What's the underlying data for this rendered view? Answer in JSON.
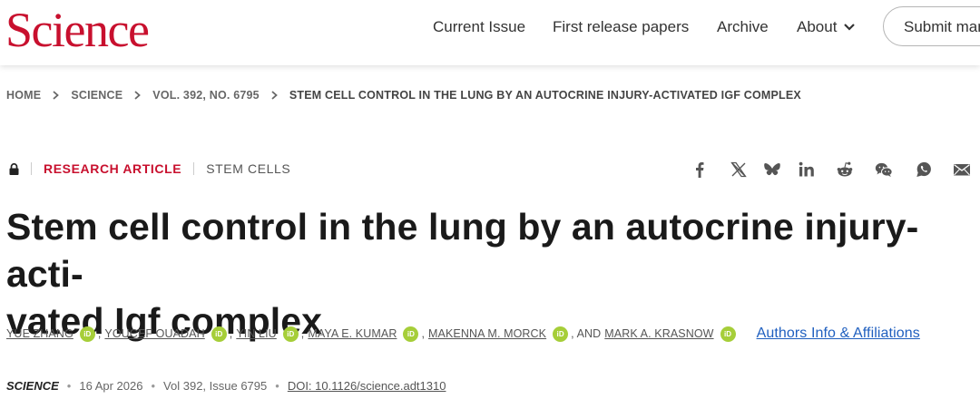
{
  "header": {
    "logo": "Science",
    "nav": [
      "Current Issue",
      "First release papers",
      "Archive",
      "About"
    ],
    "submit_label": "Submit manuscript"
  },
  "breadcrumb": [
    "HOME",
    "SCIENCE",
    "VOL. 392, NO. 6795",
    "STEM CELL CONTROL IN THE LUNG BY AN AUTOCRINE INJURY-ACTIVATED IGF COMPLEX"
  ],
  "article": {
    "type": "RESEARCH ARTICLE",
    "subject": "STEM CELLS",
    "title_lines": [
      "Stem cell control in the lung by an autocrine injury-acti-",
      "vated Igf complex"
    ],
    "orcid_label": "iD",
    "authors": [
      "YUE ZHANG",
      "YOUCEF OUADAH",
      "YIN LIU",
      "MAYA E. KUMAR",
      "MAKENNA M. MORCK",
      "MARK A. KRASNOW"
    ],
    "author_sep": ",",
    "and_label": ", AND",
    "affiliations_link": "Authors Info & Affiliations",
    "citation": {
      "journal": "SCIENCE",
      "date": "16 Apr 2026",
      "volume_issue": "Vol 392, Issue 6795",
      "doi": "DOI: 10.1126/science.adt1310",
      "separator": "•"
    }
  },
  "share_icons": [
    "facebook-icon",
    "x-twitter-icon",
    "bluesky-icon",
    "linkedin-icon",
    "reddit-icon",
    "wechat-icon",
    "whatsapp-icon",
    "email-icon"
  ],
  "colors": {
    "brand": "#c8102e",
    "link": "#1f5fbf",
    "orcid": "#a6ce39"
  }
}
